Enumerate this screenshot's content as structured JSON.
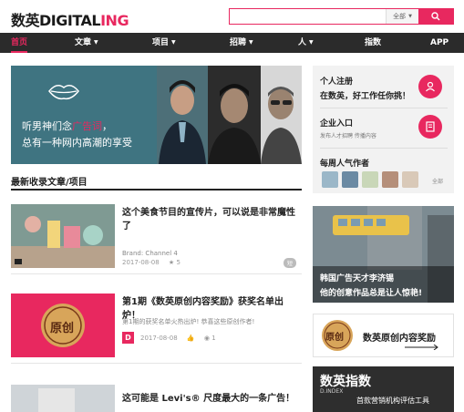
{
  "header": {
    "logo_cn": "数英",
    "logo_en": "DIGITAL",
    "logo_ing": "ING",
    "search_placeholder": "",
    "scope_label": "全部"
  },
  "nav": {
    "items": [
      {
        "label": "首页",
        "active": true
      },
      {
        "label": "文章",
        "dropdown": true
      },
      {
        "label": "项目",
        "dropdown": true
      },
      {
        "label": "招聘",
        "dropdown": true
      },
      {
        "label": "人",
        "dropdown": true
      },
      {
        "label": "指数"
      },
      {
        "label": "APP"
      }
    ]
  },
  "banner": {
    "line1_prefix": "听男神们念",
    "line1_highlight": "广告词",
    "line1_suffix": "，",
    "line2": "总有一种网内高潮的享受"
  },
  "section": {
    "title": "最新收录文章/项目"
  },
  "articles": [
    {
      "title": "这个美食节目的宣传片，可以说是非常魔性了",
      "brand": "Brand: Channel 4",
      "date": "2017-08-08",
      "likes": "5",
      "badge": "短"
    },
    {
      "title": "第1期《数英原创内容奖励》获奖名单出炉！",
      "desc": "第1期的获奖名单火热出炉! 恭喜这些原创作者!",
      "date": "2017-08-08",
      "likes": "1",
      "author_mark": "D",
      "thumb_text": "原创"
    },
    {
      "title": "这可能是 Levi's® 尺度最大的一条广告！"
    }
  ],
  "sidebar": {
    "register_title": "个人注册",
    "register_sub": "在数英，好工作任你挑！",
    "company_title": "企业入口",
    "company_sub": "发布人才招聘   传播内容",
    "popular_title": "每周人气作者",
    "all_link": "全部",
    "ad1_line1": "韩国广告天才李济锡",
    "ad1_line2": "他的创意作品总是让人惊艳!",
    "ad2_logo": "原创",
    "ad2_text": "数英原创内容奖励",
    "ad3_title": "数英指数",
    "ad3_sub": "D.INDEX",
    "ad3_desc": "首款营销机构评估工具"
  },
  "colors": {
    "accent": "#e8285f",
    "nav_bg": "#2b2b2b",
    "banner_teal": "#3f7481"
  }
}
